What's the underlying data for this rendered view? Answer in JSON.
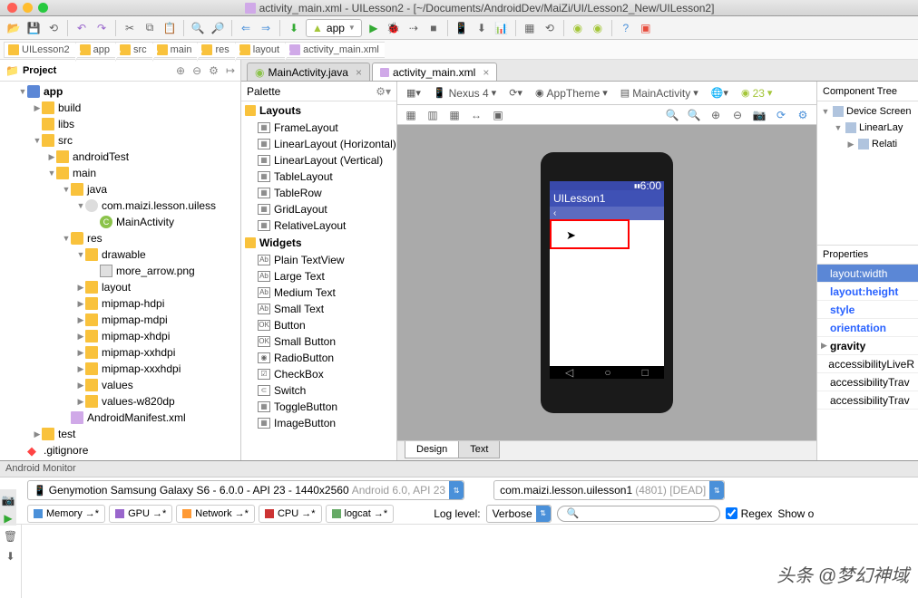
{
  "window": {
    "title": "activity_main.xml - UILesson2 - [~/Documents/AndroidDev/MaiZi/UI/Lesson2_New/UILesson2]"
  },
  "toolbar": {
    "app_dropdown": "app"
  },
  "breadcrumb": [
    "UILesson2",
    "app",
    "src",
    "main",
    "res",
    "layout",
    "activity_main.xml"
  ],
  "project_panel": {
    "title": "Project",
    "tree": [
      {
        "depth": 1,
        "arrow": "▼",
        "icon": "folder-mod",
        "label": "app",
        "bold": true
      },
      {
        "depth": 2,
        "arrow": "▶",
        "icon": "folder",
        "label": "build"
      },
      {
        "depth": 2,
        "arrow": "",
        "icon": "folder",
        "label": "libs"
      },
      {
        "depth": 2,
        "arrow": "▼",
        "icon": "folder",
        "label": "src"
      },
      {
        "depth": 3,
        "arrow": "▶",
        "icon": "folder",
        "label": "androidTest"
      },
      {
        "depth": 3,
        "arrow": "▼",
        "icon": "folder",
        "label": "main"
      },
      {
        "depth": 4,
        "arrow": "▼",
        "icon": "folder",
        "label": "java"
      },
      {
        "depth": 5,
        "arrow": "▼",
        "icon": "pkg",
        "label": "com.maizi.lesson.uiless"
      },
      {
        "depth": 6,
        "arrow": "",
        "icon": "class",
        "label": "MainActivity"
      },
      {
        "depth": 4,
        "arrow": "▼",
        "icon": "folder-res",
        "label": "res"
      },
      {
        "depth": 5,
        "arrow": "▼",
        "icon": "folder",
        "label": "drawable"
      },
      {
        "depth": 6,
        "arrow": "",
        "icon": "img",
        "label": "more_arrow.png"
      },
      {
        "depth": 5,
        "arrow": "▶",
        "icon": "folder",
        "label": "layout"
      },
      {
        "depth": 5,
        "arrow": "▶",
        "icon": "folder",
        "label": "mipmap-hdpi"
      },
      {
        "depth": 5,
        "arrow": "▶",
        "icon": "folder",
        "label": "mipmap-mdpi"
      },
      {
        "depth": 5,
        "arrow": "▶",
        "icon": "folder",
        "label": "mipmap-xhdpi"
      },
      {
        "depth": 5,
        "arrow": "▶",
        "icon": "folder",
        "label": "mipmap-xxhdpi"
      },
      {
        "depth": 5,
        "arrow": "▶",
        "icon": "folder",
        "label": "mipmap-xxxhdpi"
      },
      {
        "depth": 5,
        "arrow": "▶",
        "icon": "folder",
        "label": "values"
      },
      {
        "depth": 5,
        "arrow": "▶",
        "icon": "folder",
        "label": "values-w820dp"
      },
      {
        "depth": 4,
        "arrow": "",
        "icon": "xml",
        "label": "AndroidManifest.xml"
      },
      {
        "depth": 2,
        "arrow": "▶",
        "icon": "folder",
        "label": "test"
      },
      {
        "depth": 1,
        "arrow": "",
        "icon": "git",
        "label": ".gitignore"
      }
    ]
  },
  "tabs": [
    {
      "label": "MainActivity.java",
      "active": false
    },
    {
      "label": "activity_main.xml",
      "active": true
    }
  ],
  "palette": {
    "title": "Palette",
    "sections": [
      {
        "label": "Layouts",
        "items": [
          "FrameLayout",
          "LinearLayout (Horizontal)",
          "LinearLayout (Vertical)",
          "TableLayout",
          "TableRow",
          "GridLayout",
          "RelativeLayout"
        ]
      },
      {
        "label": "Widgets",
        "items": [
          "Plain TextView",
          "Large Text",
          "Medium Text",
          "Small Text",
          "Button",
          "Small Button",
          "RadioButton",
          "CheckBox",
          "Switch",
          "ToggleButton",
          "ImageButton"
        ]
      }
    ]
  },
  "design_toolbar": {
    "device": "Nexus 4",
    "theme": "AppTheme",
    "activity": "MainActivity",
    "api": "23"
  },
  "phone_preview": {
    "status_time": "6:00",
    "app_title": "UILesson1"
  },
  "design_tabs": [
    "Design",
    "Text"
  ],
  "component_tree": {
    "title": "Component Tree",
    "items": [
      {
        "depth": 0,
        "icon": "screen",
        "label": "Device Screen"
      },
      {
        "depth": 1,
        "icon": "layout",
        "label": "LinearLay"
      },
      {
        "depth": 2,
        "icon": "layout",
        "label": "Relati"
      }
    ]
  },
  "properties": {
    "title": "Properties",
    "rows": [
      {
        "label": "layout:width",
        "sel": true
      },
      {
        "label": "layout:height",
        "link": true
      },
      {
        "label": "style",
        "link": true
      },
      {
        "label": "orientation",
        "link": true
      },
      {
        "label": "gravity",
        "bold": true,
        "arrow": true
      },
      {
        "label": "accessibilityLiveR"
      },
      {
        "label": "accessibilityTrav"
      },
      {
        "label": "accessibilityTrav"
      }
    ]
  },
  "monitor": {
    "title": "Android Monitor",
    "device": "Genymotion Samsung Galaxy S6 - 6.0.0 - API 23 - 1440x2560",
    "device_sub": "Android 6.0, API 23",
    "process": "com.maizi.lesson.uilesson1",
    "process_sub": "(4801) [DEAD]",
    "tabs": [
      {
        "color": "#4a90d9",
        "label": "Memory"
      },
      {
        "color": "#9966cc",
        "label": "GPU"
      },
      {
        "color": "#ff9933",
        "label": "Network"
      },
      {
        "color": "#cc3333",
        "label": "CPU"
      },
      {
        "color": "#66aa66",
        "label": "logcat"
      }
    ],
    "log_level_label": "Log level:",
    "log_level": "Verbose",
    "search_placeholder": "",
    "regex": "Regex",
    "show": "Show o"
  },
  "watermark": "头条 @梦幻神域"
}
